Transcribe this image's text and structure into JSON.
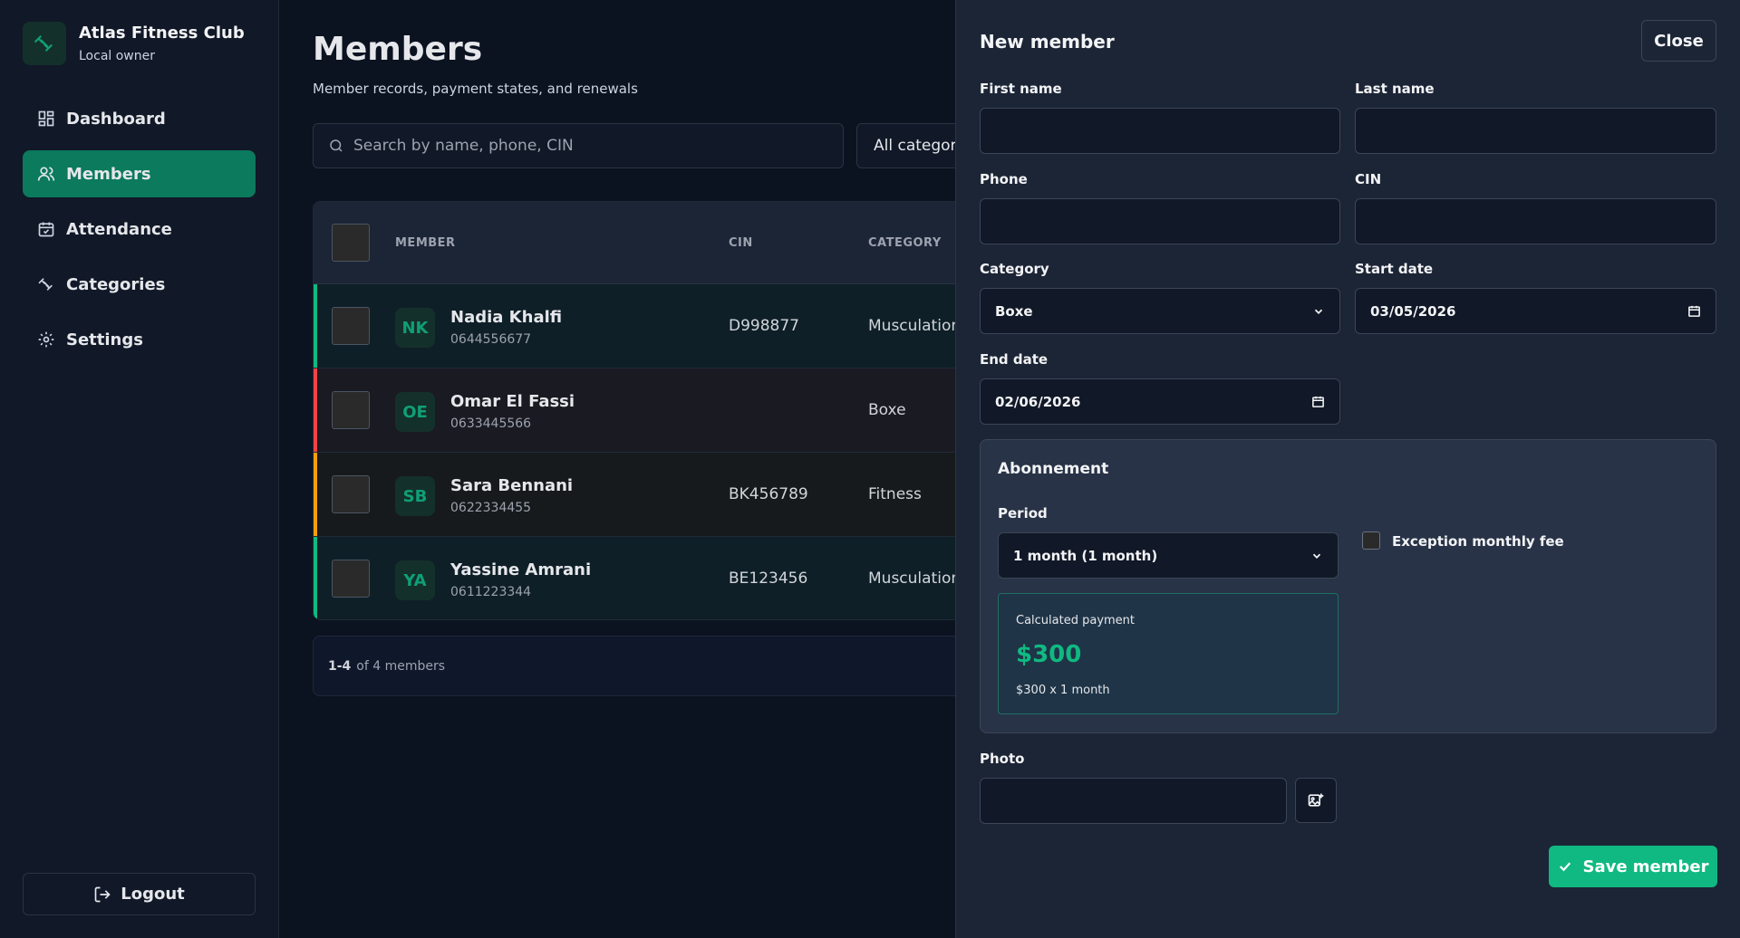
{
  "brand": {
    "name": "Atlas Fitness Club",
    "subtitle": "Local owner"
  },
  "nav": [
    {
      "label": "Dashboard",
      "icon": "dashboard-icon",
      "active": false
    },
    {
      "label": "Members",
      "icon": "users-icon",
      "active": true
    },
    {
      "label": "Attendance",
      "icon": "calendar-check-icon",
      "active": false
    },
    {
      "label": "Categories",
      "icon": "dumbbell-icon",
      "active": false
    },
    {
      "label": "Settings",
      "icon": "gear-icon",
      "active": false
    }
  ],
  "logout_label": "Logout",
  "page": {
    "title": "Members",
    "subtitle": "Member records, payment states, and renewals",
    "search_placeholder": "Search by name, phone, CIN",
    "category_filter": "All categories"
  },
  "table": {
    "headers": {
      "member": "MEMBER",
      "cin": "CIN",
      "category": "CATEGORY"
    },
    "rows": [
      {
        "initials": "NK",
        "name": "Nadia Khalfi",
        "phone": "0644556677",
        "cin": "D998877",
        "category": "Musculation",
        "status_color": "#10b981"
      },
      {
        "initials": "OE",
        "name": "Omar El Fassi",
        "phone": "0633445566",
        "cin": "",
        "category": "Boxe",
        "status_color": "#ef4444"
      },
      {
        "initials": "SB",
        "name": "Sara Bennani",
        "phone": "0622334455",
        "cin": "BK456789",
        "category": "Fitness",
        "status_color": "#f59e0b"
      },
      {
        "initials": "YA",
        "name": "Yassine Amrani",
        "phone": "0611223344",
        "cin": "BE123456",
        "category": "Musculation",
        "status_color": "#10b981"
      }
    ]
  },
  "pager": {
    "range": "1-4",
    "total_text": "of 4 members"
  },
  "drawer": {
    "title": "New member",
    "close_label": "Close",
    "labels": {
      "first_name": "First name",
      "last_name": "Last name",
      "phone": "Phone",
      "cin": "CIN",
      "category": "Category",
      "start_date": "Start date",
      "end_date": "End date",
      "photo": "Photo"
    },
    "values": {
      "first_name": "",
      "last_name": "",
      "phone": "",
      "cin": "",
      "category": "Boxe",
      "start_date": "03/05/2026",
      "end_date": "02/06/2026",
      "photo": ""
    },
    "abonnement": {
      "title": "Abonnement",
      "period_label": "Period",
      "period_value": "1 month (1 month)",
      "exception_label": "Exception monthly fee",
      "calc_label": "Calculated payment",
      "calc_amount": "$300",
      "calc_detail": "$300 x 1 month"
    },
    "save_label": "Save member"
  },
  "colors": {
    "accent": "#10b981",
    "active_nav": "#0b7a5d"
  }
}
